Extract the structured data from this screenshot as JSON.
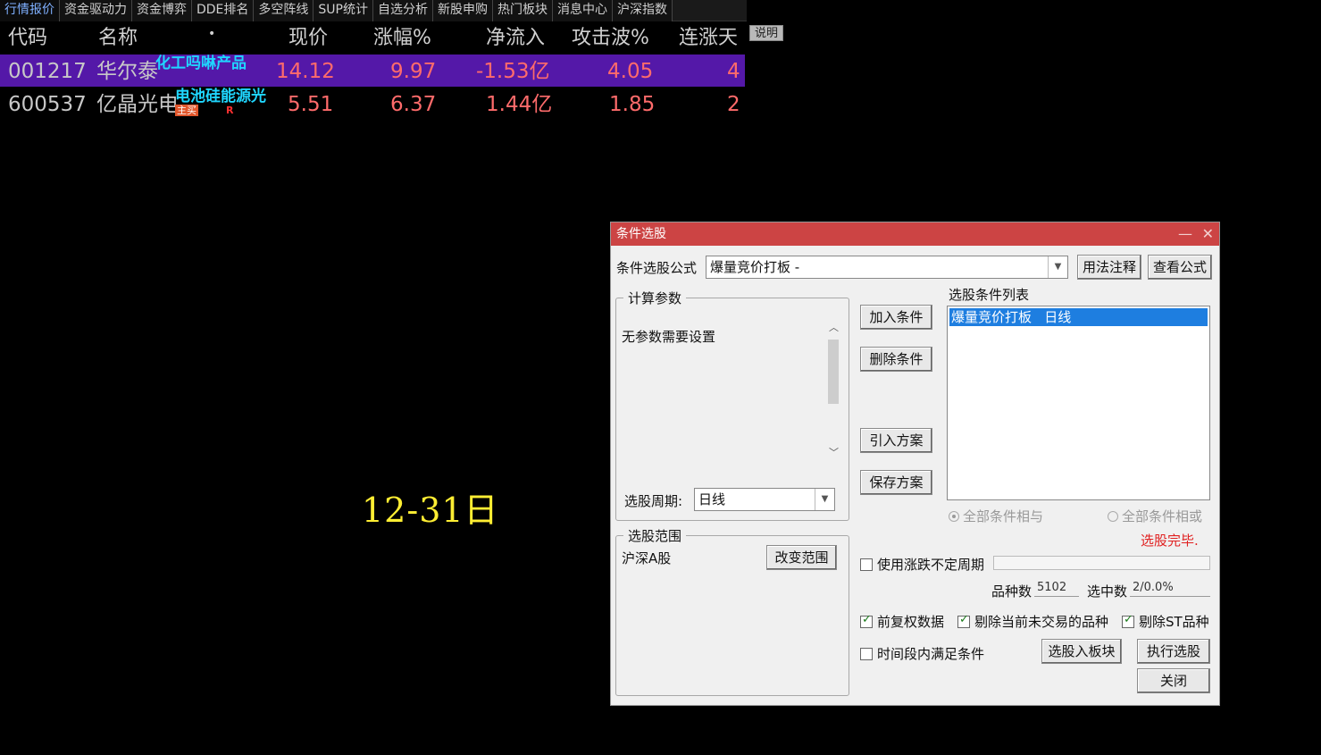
{
  "tabs": [
    "行情报价",
    "资金驱动力",
    "资金博弈",
    "DDE排名",
    "多空阵线",
    "SUP统计",
    "自选分析",
    "新股申购",
    "热门板块",
    "消息中心",
    "沪深指数"
  ],
  "active_tab": 0,
  "table": {
    "headers": {
      "code": "代码",
      "name": "名称",
      "dot": "•",
      "price": "现价",
      "pct": "涨幅%",
      "flow": "净流入",
      "attack": "攻击波%",
      "days": "连涨天"
    },
    "note_button": "说明",
    "rows": [
      {
        "code": "001217",
        "name": "华尔泰",
        "tag": "化工吗啉产品",
        "sub": "",
        "sub2": "",
        "price": "14.12",
        "pct": "9.97",
        "flow": "-1.53亿",
        "attack": "4.05",
        "days": "4"
      },
      {
        "code": "600537",
        "name": "亿晶光电",
        "tag": "电池硅能源光",
        "sub": "主买",
        "sub2": "R",
        "price": "5.51",
        "pct": "6.37",
        "flow": "1.44亿",
        "attack": "1.85",
        "days": "2"
      }
    ]
  },
  "date_label": "12-31日",
  "dialog": {
    "title": "条件选股",
    "minimize": "—",
    "close": "✕",
    "formula_label": "条件选股公式",
    "formula_value": "爆量竞价打板 -",
    "usage_button": "用法注释",
    "view_formula_button": "查看公式",
    "params_group": "计算参数",
    "params_text": "无参数需要设置",
    "period_label": "选股周期:",
    "period_value": "日线",
    "add_button": "加入条件",
    "delete_button": "删除条件",
    "import_button": "引入方案",
    "save_button": "保存方案",
    "list_label": "选股条件列表",
    "list_items": [
      "爆量竞价打板   日线"
    ],
    "radio_and": "全部条件相与",
    "radio_or": "全部条件相或",
    "status": "选股完毕.",
    "range_group": "选股范围",
    "range_value": "沪深A股",
    "change_range_button": "改变范围",
    "chk_variable_period": "使用涨跌不定周期",
    "count_label": "品种数",
    "count_value": "5102",
    "selected_label": "选中数",
    "selected_value": "2/0.0%",
    "chk_adjusted": "前复权数据",
    "chk_exclude_untraded": "剔除当前未交易的品种",
    "chk_exclude_st": "剔除ST品种",
    "chk_time_range": "时间段内满足条件",
    "to_block_button": "选股入板块",
    "run_button": "执行选股",
    "close_button": "关闭"
  }
}
